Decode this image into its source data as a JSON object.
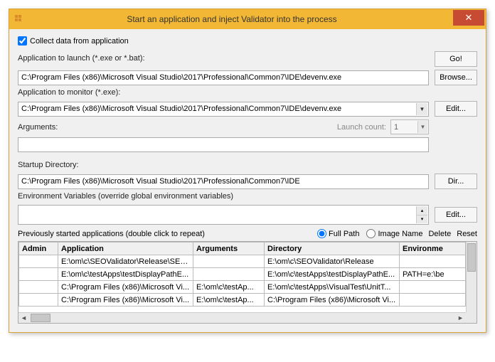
{
  "title": "Start an application and inject Validator into the process",
  "checkbox_collect": "Collect data from application",
  "app_launch": {
    "label": "Application to launch (*.exe or *.bat):",
    "value": "C:\\Program Files (x86)\\Microsoft Visual Studio\\2017\\Professional\\Common7\\IDE\\devenv.exe"
  },
  "app_monitor": {
    "label": "Application to monitor (*.exe):",
    "value": "C:\\Program Files (x86)\\Microsoft Visual Studio\\2017\\Professional\\Common7\\IDE\\devenv.exe"
  },
  "arguments": {
    "label": "Arguments:",
    "value": ""
  },
  "launch_count": {
    "label": "Launch count:",
    "value": "1"
  },
  "startup_dir": {
    "label": "Startup Directory:",
    "value": "C:\\Program Files (x86)\\Microsoft Visual Studio\\2017\\Professional\\Common7\\IDE"
  },
  "env_label": "Environment Variables (override global environment variables)",
  "prev_label": "Previously started applications (double click to repeat)",
  "radio": {
    "full_path": "Full Path",
    "image_name": "Image Name"
  },
  "buttons": {
    "go": "Go!",
    "browse": "Browse...",
    "edit": "Edit...",
    "dir": "Dir...",
    "edit2": "Edit...",
    "delete": "Delete",
    "reset": "Reset"
  },
  "table": {
    "headers": [
      "Admin",
      "Application",
      "Arguments",
      "Directory",
      "Environme"
    ],
    "rows": [
      [
        "",
        "E:\\om\\c\\SEOValidator\\Release\\SEO...",
        "",
        "E:\\om\\c\\SEOValidator\\Release",
        ""
      ],
      [
        "",
        "E:\\om\\c\\testApps\\testDisplayPathE...",
        "",
        "E:\\om\\c\\testApps\\testDisplayPathE...",
        "PATH=e:\\be"
      ],
      [
        "",
        "C:\\Program Files (x86)\\Microsoft Vi...",
        "E:\\om\\c\\testAp...",
        "E:\\om\\c\\testApps\\VisualTest\\UnitT...",
        ""
      ],
      [
        "",
        "C:\\Program Files (x86)\\Microsoft Vi...",
        "E:\\om\\c\\testAp...",
        "C:\\Program Files (x86)\\Microsoft Vi...",
        ""
      ]
    ]
  }
}
